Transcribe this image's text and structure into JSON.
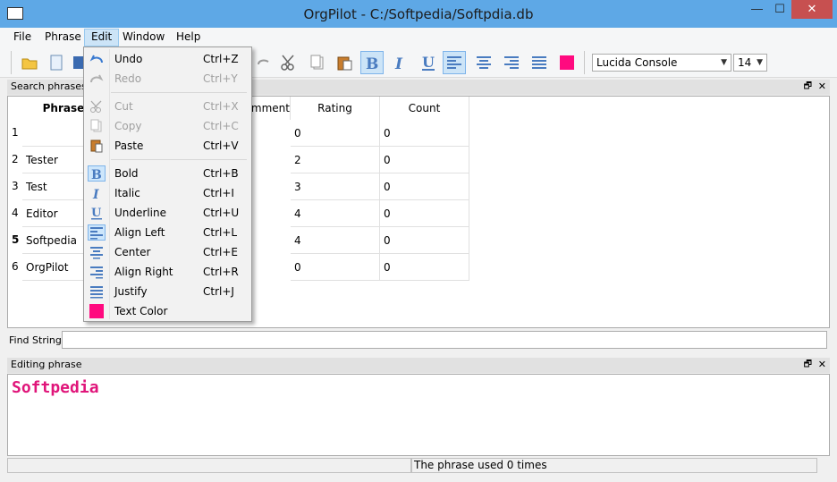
{
  "window": {
    "title": "OrgPilot - C:/Softpedia/Softpdia.db",
    "min": "—",
    "max": "☐",
    "close": "✕"
  },
  "menu": {
    "file": "File",
    "phrase": "Phrase",
    "edit": "Edit",
    "window": "Window",
    "help": "Help"
  },
  "toolbar": {
    "font": "Lucida Console",
    "size": "14",
    "color_swatch": "#ff0a7f"
  },
  "search_panel": {
    "title": "Search phrases",
    "dock": "🗗",
    "close": "✕"
  },
  "table": {
    "columns": [
      "Phrases",
      "Comment",
      "Rating",
      "Count"
    ],
    "rows": [
      {
        "num": "1",
        "phrase": "",
        "rating": "0",
        "count": "0"
      },
      {
        "num": "2",
        "phrase": "Tester",
        "rating": "2",
        "count": "0"
      },
      {
        "num": "3",
        "phrase": "Test",
        "rating": "3",
        "count": "0"
      },
      {
        "num": "4",
        "phrase": "Editor",
        "rating": "4",
        "count": "0"
      },
      {
        "num": "5",
        "phrase": "Softpedia",
        "rating": "4",
        "count": "0"
      },
      {
        "num": "6",
        "phrase": "OrgPilot",
        "rating": "0",
        "count": "0"
      }
    ]
  },
  "find": {
    "label": "Find Strings",
    "value": ""
  },
  "editing_panel": {
    "title": "Editing phrase",
    "content": "Softpedia",
    "text_color": "#e0157a"
  },
  "status": {
    "message": "The phrase used 0 times"
  },
  "edit_menu": {
    "undo": {
      "label": "Undo",
      "shortcut": "Ctrl+Z"
    },
    "redo": {
      "label": "Redo",
      "shortcut": "Ctrl+Y"
    },
    "cut": {
      "label": "Cut",
      "shortcut": "Ctrl+X"
    },
    "copy": {
      "label": "Copy",
      "shortcut": "Ctrl+C"
    },
    "paste": {
      "label": "Paste",
      "shortcut": "Ctrl+V"
    },
    "bold": {
      "label": "Bold",
      "shortcut": "Ctrl+B"
    },
    "italic": {
      "label": "Italic",
      "shortcut": "Ctrl+I"
    },
    "underline": {
      "label": "Underline",
      "shortcut": "Ctrl+U"
    },
    "align_left": {
      "label": "Align Left",
      "shortcut": "Ctrl+L"
    },
    "center": {
      "label": "Center",
      "shortcut": "Ctrl+E"
    },
    "align_right": {
      "label": "Align Right",
      "shortcut": "Ctrl+R"
    },
    "justify": {
      "label": "Justify",
      "shortcut": "Ctrl+J"
    },
    "text_color": {
      "label": "Text Color"
    }
  },
  "colors": {
    "accent": "#5ea8e6",
    "text_color_swatch": "#ff0a7f",
    "selection": "#cce4f7"
  }
}
